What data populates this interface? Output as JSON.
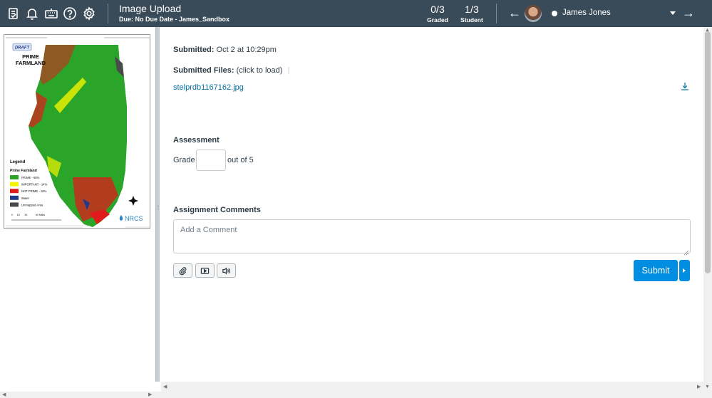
{
  "topbar": {
    "title": "Image Upload",
    "subtitle": "Due: No Due Date - James_Sandbox",
    "graded_value": "0/3",
    "graded_label": "Graded",
    "student_value": "1/3",
    "student_label": "Student",
    "student_name": "James Jones",
    "icons": [
      "assignments-icon",
      "bell-icon",
      "keyboard-icon",
      "help-icon",
      "gear-icon"
    ]
  },
  "map": {
    "draft_label": "DRAFT",
    "title": "PRIME FARMLAND",
    "legend_title": "Legend",
    "legend_subtitle": "Prime Farmland",
    "legend_items": [
      {
        "label": "PRIME - 68%",
        "color": "#2aa52a"
      },
      {
        "label": "IMPORTANT - 14%",
        "color": "#f4f400"
      },
      {
        "label": "NOT PRIME - 18%",
        "color": "#e01b1b"
      },
      {
        "label": "Water",
        "color": "#1e3a8a"
      },
      {
        "label": "Unmapped Area",
        "color": "#4a4a4a"
      }
    ],
    "logo_text": "NRCS"
  },
  "submission": {
    "submitted_label": "Submitted:",
    "submitted_value": "Oct 2 at 10:29pm",
    "files_label": "Submitted Files:",
    "files_hint": "(click to load)",
    "file_name": "stelprdb1167162.jpg"
  },
  "assessment": {
    "heading": "Assessment",
    "grade_label": "Grade",
    "grade_value": "",
    "out_of": "out of 5"
  },
  "comments": {
    "heading": "Assignment Comments",
    "placeholder": "Add a Comment",
    "submit_label": "Submit"
  },
  "colors": {
    "topbar": "#394b58",
    "link": "#0770a3",
    "primary": "#008ee2"
  }
}
